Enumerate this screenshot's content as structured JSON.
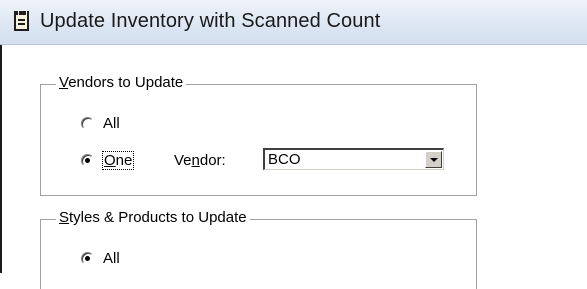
{
  "window": {
    "title": "Update Inventory with Scanned Count",
    "icon": "clipboard-icon"
  },
  "vendors_group": {
    "legend": "Vendors to Update",
    "options": [
      {
        "label": "All",
        "checked": false
      },
      {
        "label": "One",
        "checked": true
      }
    ],
    "vendor_label": "Vendor:",
    "vendor_value": "BCO"
  },
  "styles_group": {
    "legend": "Styles & Products to Update",
    "options": [
      {
        "label": "All",
        "checked": true
      }
    ]
  }
}
